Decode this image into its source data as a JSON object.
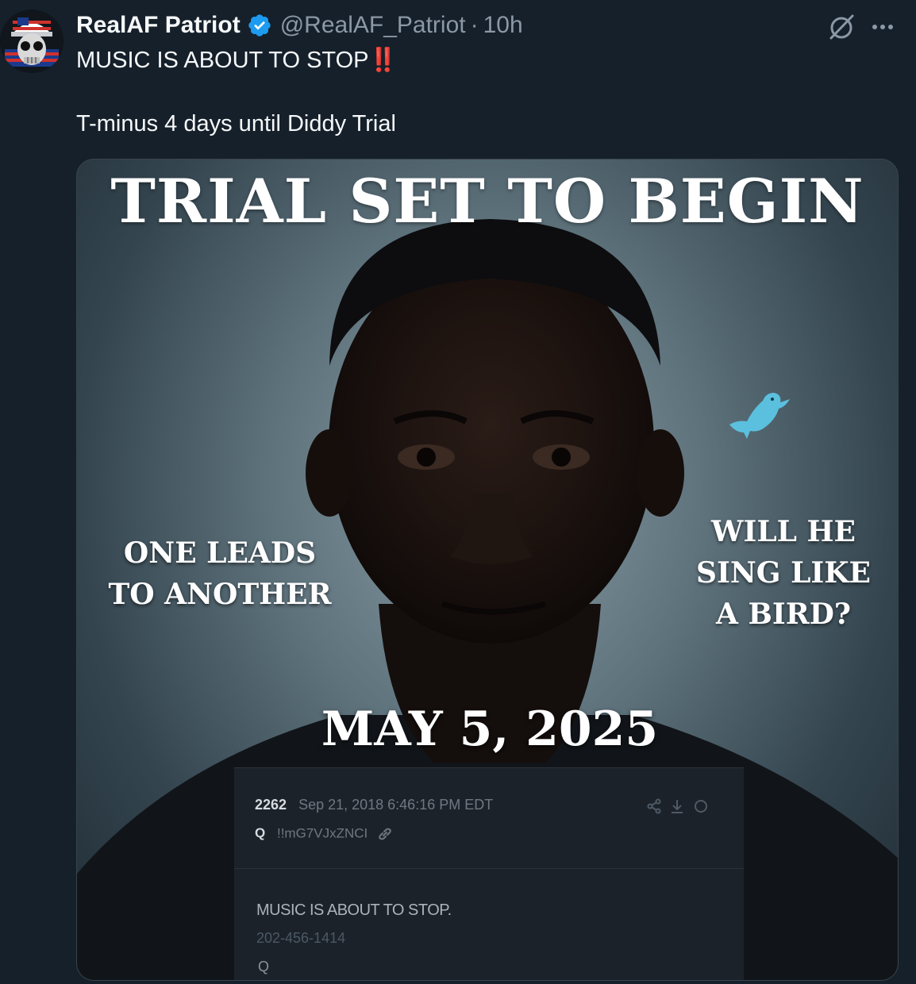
{
  "tweet": {
    "display_name": "RealAF Patriot",
    "handle": "@RealAF_Patriot",
    "separator": "·",
    "time": "10h",
    "text_line1": "MUSIC IS ABOUT TO STOP‼️",
    "text_line2": "T-minus 4 days until Diddy Trial",
    "icons": {
      "avatar": "skull-flag-avatar",
      "verified": "verified-badge-icon",
      "grok": "grok-icon",
      "more": "more-icon"
    }
  },
  "media": {
    "headline": "TRIAL SET TO BEGIN",
    "caption_left_1": "ONE LEADS",
    "caption_left_2": "TO ANOTHER",
    "caption_right_1": "WILL HE",
    "caption_right_2": "SING LIKE",
    "caption_right_3": "A BIRD?",
    "date": "MAY 5, 2025",
    "qpost": {
      "number": "2262",
      "datetime": "Sep 21, 2018 6:46:16 PM EDT",
      "q": "Q",
      "tripcode": "!!mG7VJxZNCI",
      "body_line1": "MUSIC IS ABOUT TO STOP.",
      "body_line2": "202-456-1414",
      "body_line3": "Q"
    }
  },
  "colors": {
    "background": "#15202b",
    "verified": "#1d9bf0",
    "muted": "#8b98a5",
    "bird": "#5bc0de"
  }
}
